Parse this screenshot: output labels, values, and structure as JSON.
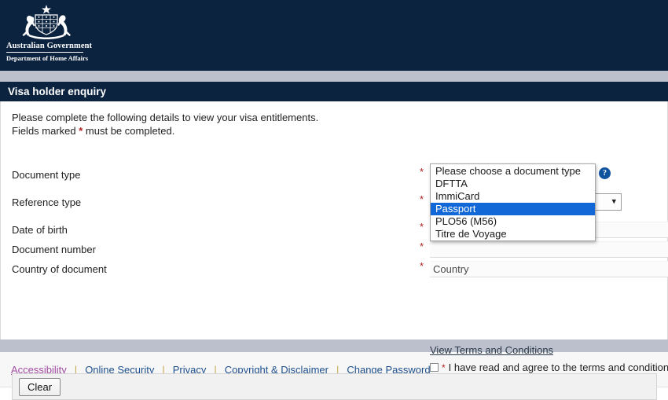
{
  "masthead": {
    "crest_icon": "australian-coat-of-arms",
    "line1": "Australian Government",
    "line2": "Department of Home Affairs"
  },
  "title_bar": {
    "title": "Visa holder enquiry"
  },
  "intro": {
    "line1": "Please complete the following details to view your visa entitlements.",
    "line2_prefix": "Fields marked ",
    "line2_star": "*",
    "line2_suffix": " must be completed."
  },
  "form": {
    "required_marker": "*",
    "fields": [
      {
        "label": "Document type",
        "type": "select",
        "value": "Please choose a document type",
        "required": true,
        "help_icon": "question-mark-circle-icon",
        "help_label": "?"
      },
      {
        "label": "Reference type",
        "type": "select",
        "value": "",
        "required": true
      },
      {
        "label": "Date of birth",
        "type": "text",
        "value": "",
        "placeholder": "",
        "required": true
      },
      {
        "label": "Document number",
        "type": "text",
        "value": "",
        "placeholder": "",
        "required": true
      },
      {
        "label": "Country of document",
        "type": "text",
        "value": "",
        "placeholder": "Country",
        "required": true
      }
    ],
    "chevron_glyph": "⌄"
  },
  "dropdown": {
    "open": true,
    "options": [
      "Please choose a document type",
      "DFTTA",
      "ImmiCard",
      "Passport",
      "PLO56 (M56)",
      "Titre de Voyage"
    ],
    "selected_index": 3,
    "highlight_color": "#1168d6"
  },
  "terms": {
    "link_label": "View Terms and Conditions",
    "required_marker": "*",
    "checkbox_label": "I have read and agree to the terms and conditions",
    "checked": false
  },
  "actions": {
    "clear_label": "Clear"
  },
  "footer": {
    "links": [
      {
        "label": "Accessibility",
        "visited": true
      },
      {
        "label": "Online Security",
        "visited": false
      },
      {
        "label": "Privacy",
        "visited": false
      },
      {
        "label": "Copyright & Disclaimer",
        "visited": false
      },
      {
        "label": "Change Password",
        "visited": false
      }
    ],
    "separator": "|"
  },
  "colors": {
    "navy": "#0c2340",
    "band_gray": "#bcc0cc",
    "required_red": "#b32020",
    "link_blue": "#1d4f8c",
    "visited_purple": "#a34ba3",
    "help_blue": "#11549e"
  }
}
